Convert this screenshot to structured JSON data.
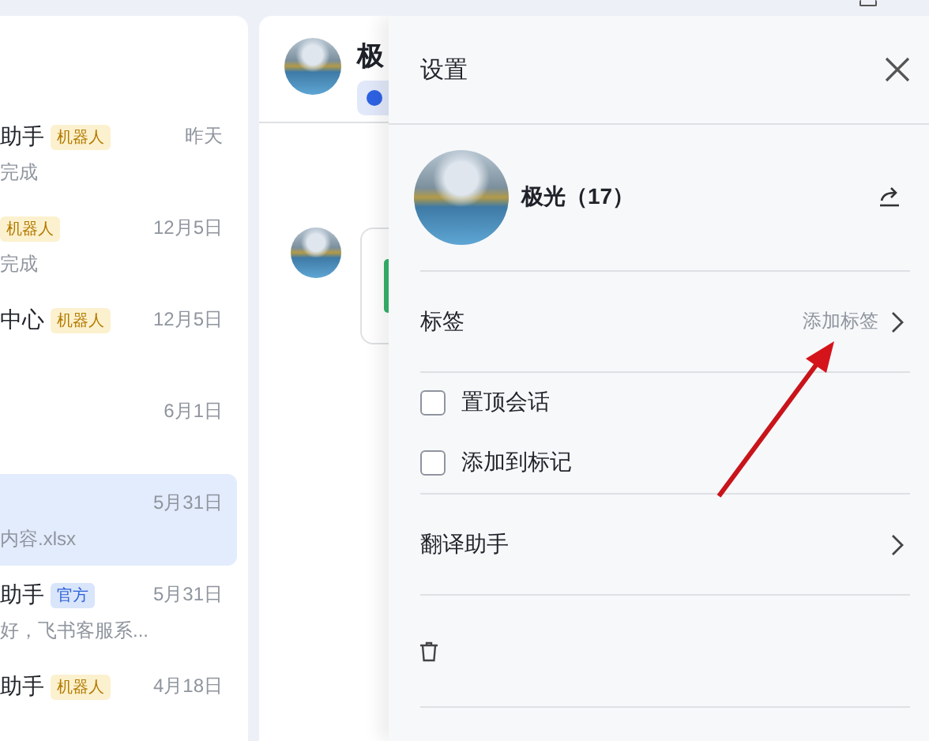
{
  "conversations": [
    {
      "name": "助手",
      "tag": {
        "text": "机器人",
        "kind": "bot"
      },
      "time": "昨天",
      "preview": "完成",
      "selected": false
    },
    {
      "tag": {
        "text": "机器人",
        "kind": "bot"
      },
      "time": "12月5日",
      "preview": "完成",
      "selected": false
    },
    {
      "name": "中心",
      "tag": {
        "text": "机器人",
        "kind": "bot"
      },
      "time": "12月5日",
      "selected": false
    },
    {
      "time": "6月1日",
      "selected": false
    },
    {
      "time": "5月31日",
      "preview": "内容.xlsx",
      "selected": true
    },
    {
      "name": "助手",
      "tag": {
        "text": "官方",
        "kind": "official"
      },
      "time": "5月31日",
      "preview": "好，飞书客服系...",
      "selected": false
    },
    {
      "name": "助手",
      "tag": {
        "text": "机器人",
        "kind": "bot"
      },
      "time": "4月18日",
      "selected": false
    }
  ],
  "chat": {
    "title": "极"
  },
  "settings": {
    "title": "设置",
    "group_name": "极光（17）",
    "rows": [
      {
        "kind": "link",
        "label": "标签",
        "value": "添加标签"
      },
      {
        "kind": "checkbox",
        "label": "置顶会话",
        "checked": false
      },
      {
        "kind": "checkbox",
        "label": "添加到标记",
        "checked": false
      },
      {
        "kind": "link",
        "label": "翻译助手"
      },
      {
        "kind": "action"
      }
    ]
  }
}
